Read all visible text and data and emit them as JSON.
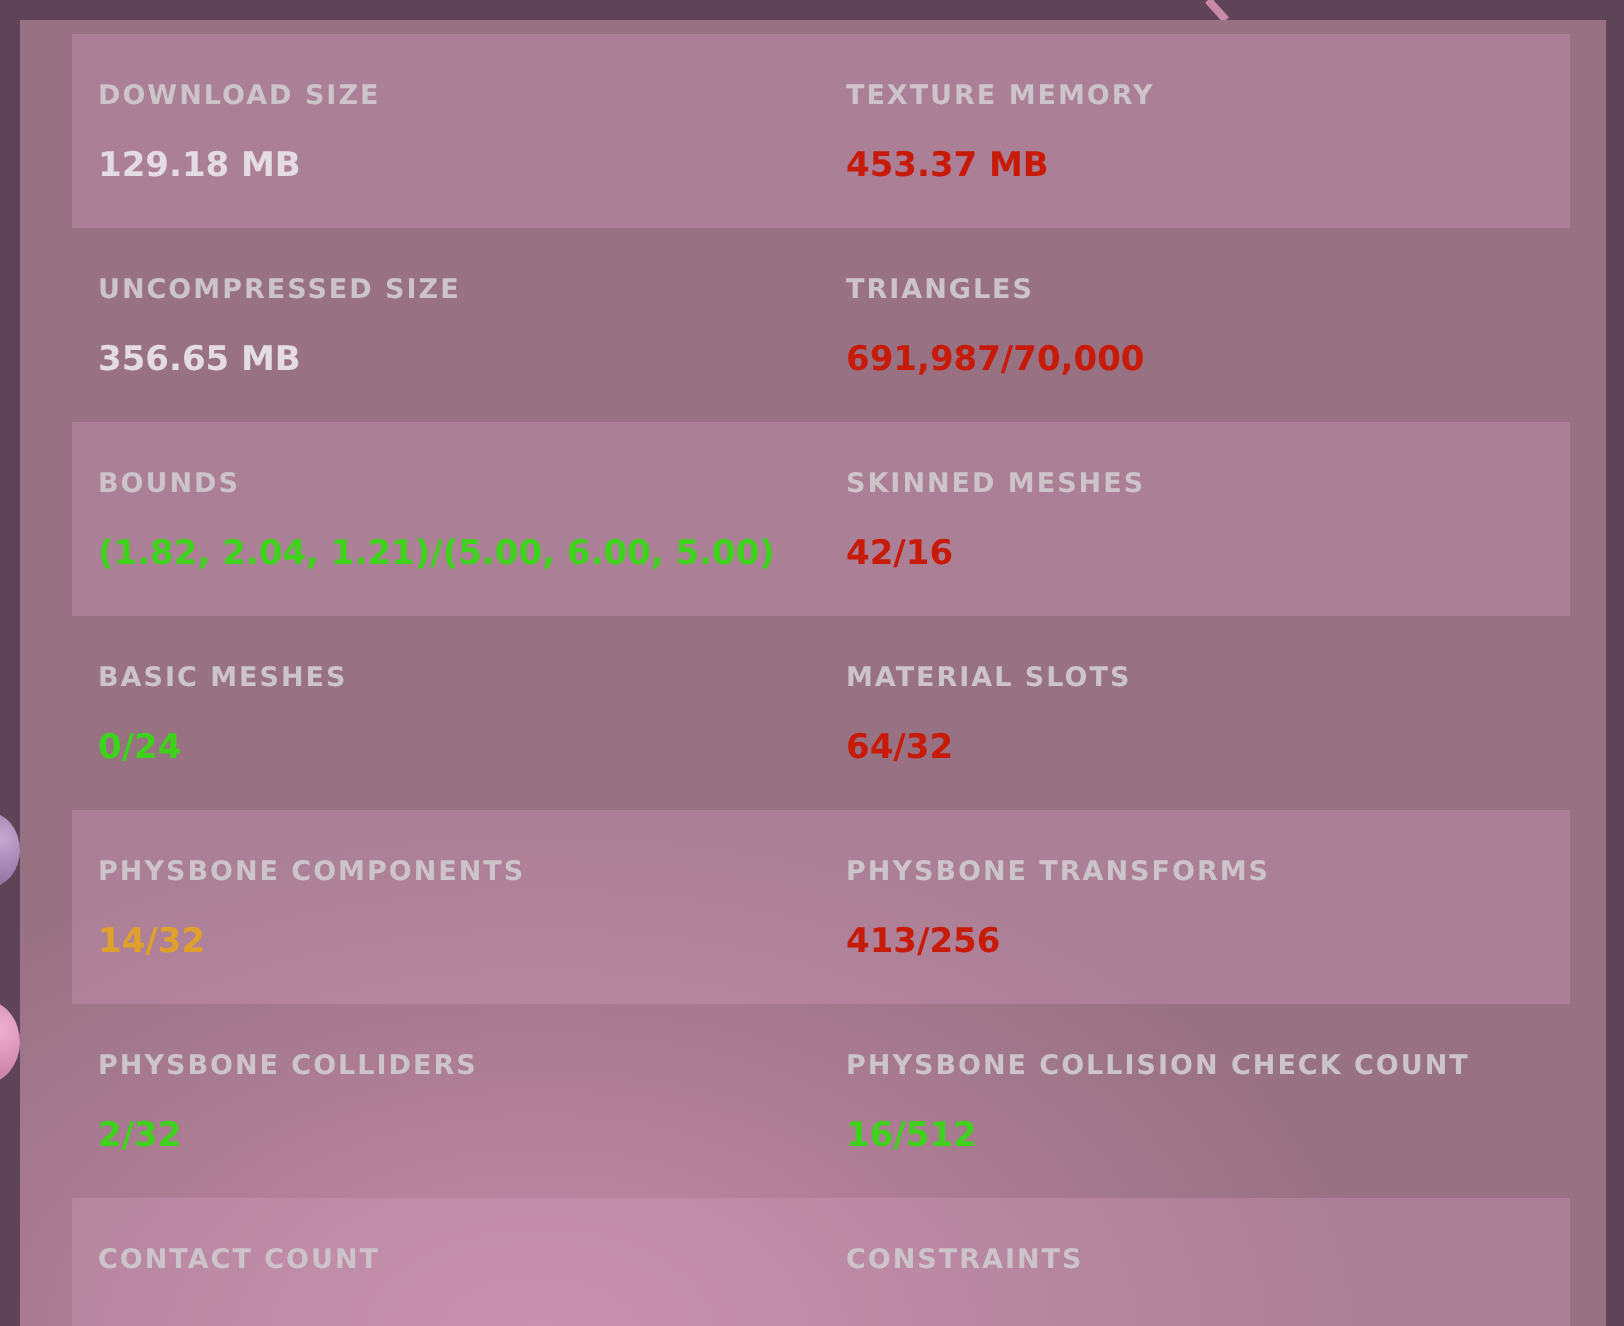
{
  "rows": [
    {
      "cells": [
        {
          "label": "DOWNLOAD SIZE",
          "value": "129.18 MB",
          "color": "#e4dce2"
        },
        {
          "label": "TEXTURE MEMORY",
          "value": "453.37 MB",
          "color": "#c81a08"
        }
      ]
    },
    {
      "cells": [
        {
          "label": "UNCOMPRESSED SIZE",
          "value": "356.65 MB",
          "color": "#e4dce2"
        },
        {
          "label": "TRIANGLES",
          "value": "691,987/70,000",
          "color": "#c81a08"
        }
      ]
    },
    {
      "cells": [
        {
          "label": "BOUNDS",
          "value": "(1.82, 2.04, 1.21)/(5.00, 6.00, 5.00)",
          "color": "#3ed21c"
        },
        {
          "label": "SKINNED MESHES",
          "value": "42/16",
          "color": "#c81a08"
        }
      ]
    },
    {
      "cells": [
        {
          "label": "BASIC MESHES",
          "value": "0/24",
          "color": "#3ed21c"
        },
        {
          "label": "MATERIAL SLOTS",
          "value": "64/32",
          "color": "#c81a08"
        }
      ]
    },
    {
      "cells": [
        {
          "label": "PHYSBONE COMPONENTS",
          "value": "14/32",
          "color": "#e0a02c"
        },
        {
          "label": "PHYSBONE TRANSFORMS",
          "value": "413/256",
          "color": "#c81a08"
        }
      ]
    },
    {
      "cells": [
        {
          "label": "PHYSBONE COLLIDERS",
          "value": "2/32",
          "color": "#3ed21c"
        },
        {
          "label": "PHYSBONE COLLISION CHECK COUNT",
          "value": "16/512",
          "color": "#3ed21c"
        }
      ]
    },
    {
      "cells": [
        {
          "label": "CONTACT COUNT"
        },
        {
          "label": "CONSTRAINTS"
        }
      ]
    }
  ]
}
